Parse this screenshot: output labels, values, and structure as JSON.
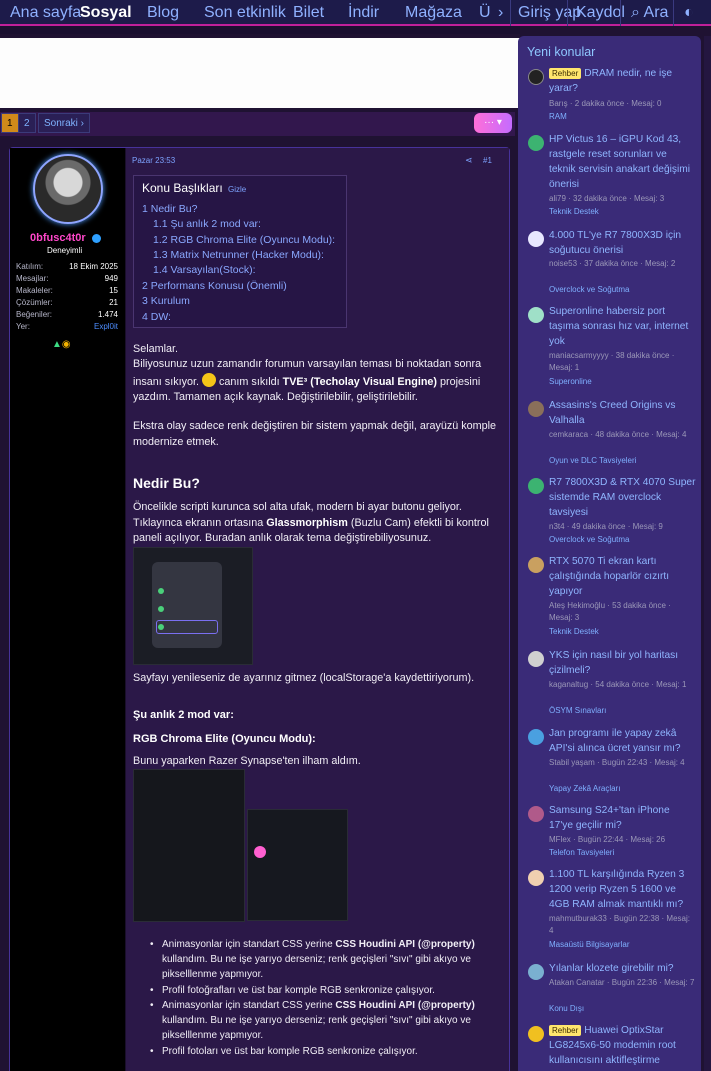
{
  "nav": {
    "items": [
      "Ana sayfa",
      "Sosyal",
      "Blog",
      "Son etkinlik",
      "Bilet",
      "İndir",
      "Mağaza",
      "Ü"
    ],
    "chevron": "›",
    "login": "Giriş yap",
    "register": "Kaydol",
    "search": "Ara",
    "search_icon": "search-icon",
    "theme_icon": "theme-toggle-icon"
  },
  "pagination": {
    "p1": "1",
    "p2": "2",
    "next": "Sonraki ›",
    "more": "··· ▾"
  },
  "post": {
    "time": "Pazar 23:53",
    "num": "#1",
    "user": {
      "name": "0bfusc4t0r",
      "title": "Deneyimli",
      "stats": [
        {
          "k": "Katılım:",
          "v": "18 Ekim 2025"
        },
        {
          "k": "Mesajlar:",
          "v": "949"
        },
        {
          "k": "Makaleler:",
          "v": "15"
        },
        {
          "k": "Çözümler:",
          "v": "21"
        },
        {
          "k": "Beğeniler:",
          "v": "1.474"
        },
        {
          "k": "Yer:",
          "v": "Expl0it"
        }
      ]
    },
    "toc": {
      "title": "Konu Başlıkları",
      "hide": "Gizle",
      "items": [
        "1 Nedir Bu?",
        "1.1 Şu anlık 2 mod var:",
        "1.2 RGB Chroma Elite (Oyuncu Modu):",
        "1.3 Matrix Netrunner (Hacker Modu):",
        "1.4 Varsayılan(Stock):",
        "2 Performans Konusu (Önemli)",
        "3 Kurulum",
        "4 DW:"
      ]
    },
    "greet": "Selamlar.",
    "p1a": "Biliyosunuz uzun zamandır forumun varsayılan teması bi noktadan sonra insanı sıkıyor. ",
    "p1b": " canım sıkıldı ",
    "p1c": "TVE³ (Techolay Visual Engine)",
    "p1d": " projesini yazdım. Tamamen açık kaynak. Değiştirilebilir, geliştirilebilir.",
    "p2": "Ekstra olay sadece renk değiştiren bir sistem yapmak değil, arayüzü komple modernize etmek.",
    "h_nedir": "Nedir Bu?",
    "p3a": "Öncelikle scripti kurunca sol alta ufak, modern bi ayar butonu geliyor. Tıklayınca ekranın ortasına ",
    "p3b": "Glassmorphism",
    "p3c": " (Buzlu Cam) efektli bi kontrol paneli açılıyor. Buradan anlık olarak tema değiştirebiliyosunuz.",
    "p4": "Sayfayı yenileseniz de ayarınız gitmez (localStorage'a kaydettiriyorum).",
    "h_mod": "Şu anlık 2 mod var:",
    "h_rgb": "RGB Chroma Elite (Oyuncu Modu):",
    "p5": "Bunu yaparken Razer Synapse'ten ilham aldım.",
    "b1a": "Animasyonlar için standart CSS yerine ",
    "b1b": "CSS Houdini API (@property)",
    "b1c": " kullandım. Bu ne işe yarıyo derseniz; renk geçişleri \"sıvı\" gibi akıyo ve pikselllenme yapmıyor.",
    "b2": "Profil fotoğrafları ve üst bar komple RGB senkronize çalışıyor.",
    "b3a": "Animasyonlar için standart CSS yerine ",
    "b3b": "CSS Houdini API (@property)",
    "b3c": " kullandım. Bu ne işe yarıyo derseniz; renk geçişleri \"sıvı\" gibi akıyo ve pikselllenme yapmıyor.",
    "b4": "Profil fotoları ve üst bar komple RGB senkronize çalışıyor."
  },
  "sidebar": {
    "title": "Yeni konular",
    "items": [
      {
        "tag": "Rehber",
        "title": "DRAM nedir, ne işe yarar?",
        "meta": "Barış · 2 dakika önce · Mesaj: 0",
        "forum": "RAM",
        "color": "#222"
      },
      {
        "title": "HP Victus 16 – iGPU Kod 43, rastgele reset sorunları ve teknik servisin anakart değişimi önerisi",
        "meta": "ali79 · 32 dakika önce · Mesaj: 3",
        "forum": "Teknik Destek",
        "color": "#3cb371"
      },
      {
        "title": "4.000 TL'ye R7 7800X3D için soğutucu önerisi",
        "meta": "noise53 · 37 dakika önce · Mesaj: 2",
        "forum": "Overclock ve Soğutma",
        "color": "#e8e8ff"
      },
      {
        "title": "Superonline habersiz port taşıma sonrası hız var, internet yok",
        "meta": "maniacsarmyyyy · 38 dakika önce · Mesaj: 1",
        "forum": "Superonline",
        "color": "#9fe0c8"
      },
      {
        "title": "Assasins's Creed Origins vs Valhalla",
        "meta": "cemkaraca · 48 dakika önce · Mesaj: 4",
        "forum": "Oyun ve DLC Tavsiyeleri",
        "color": "#8a6f5a"
      },
      {
        "title": "R7 7800X3D & RTX 4070 Super sistemde RAM overclock tavsiyesi",
        "meta": "n3t4 · 49 dakika önce · Mesaj: 9",
        "forum": "Overclock ve Soğutma",
        "color": "#3cb371"
      },
      {
        "title": "RTX 5070 Ti ekran kartı çalıştığında hoparlör cızırtı yapıyor",
        "meta": "Ateş Hekimoğlu · 53 dakika önce · Mesaj: 3",
        "forum": "Teknik Destek",
        "color": "#c9a060"
      },
      {
        "title": "YKS için nasıl bir yol haritası çizilmeli?",
        "meta": "kaganaltug · 54 dakika önce · Mesaj: 1",
        "forum": "ÖSYM Sınavları",
        "color": "#d0d0d0"
      },
      {
        "title": "Jan programı ile yapay zekâ API'si alınca ücret yansır mı?",
        "meta": "Stabil yaşam · Bugün 22:43 · Mesaj: 4",
        "forum": "Yapay Zekâ Araçları",
        "color": "#4aa0e0"
      },
      {
        "title": "Samsung S24+'tan iPhone 17'ye geçilir mi?",
        "meta": "MFlex · Bugün 22:44 · Mesaj: 26",
        "forum": "Telefon Tavsiyeleri",
        "color": "#b05a8a"
      },
      {
        "title": "1.100 TL karşılığında Ryzen 3 1200 verip Ryzen 5 1600 ve 4GB RAM almak mantıklı mı?",
        "meta": "mahmutburak33 · Bugün 22:38 · Mesaj: 4",
        "forum": "Masaüstü Bilgisayarlar",
        "color": "#f0d0b0"
      },
      {
        "title": "Yılanlar klozete girebilir mi?",
        "meta": "Atakan Canatar · Bugün 22:36 · Mesaj: 7",
        "forum": "Konu Dışı",
        "color": "#7ab0d0"
      },
      {
        "tag": "Rehber",
        "title": "Huawei OptixStar LG8245x6-50 modemin root kullanıcısını aktifleştirme",
        "meta": "",
        "forum": "",
        "color": "#f0c020"
      }
    ]
  }
}
